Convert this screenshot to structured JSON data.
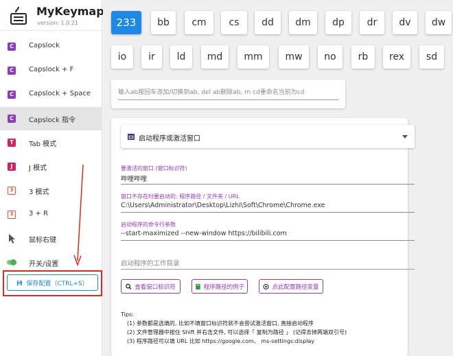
{
  "app": {
    "title": "MyKeymap",
    "version": "version: 1.0.21"
  },
  "sidebar": {
    "items": [
      {
        "badge": "C",
        "label": "Capslock"
      },
      {
        "badge": "C",
        "label": "Capslock + F"
      },
      {
        "badge": "C",
        "label": "Capslock + Space"
      },
      {
        "badge": "C",
        "label": "Capslock 指令"
      },
      {
        "badge": "T",
        "label": "Tab 模式"
      },
      {
        "badge": "J",
        "label": "J 模式"
      },
      {
        "badge": "3",
        "label": "3 模式"
      },
      {
        "badge": "3",
        "label": "3 + R"
      },
      {
        "badge": "",
        "label": "鼠标右键"
      },
      {
        "badge": "",
        "label": "开关/设置"
      }
    ],
    "save_label": "保存配置（CTRL+S）"
  },
  "keys": {
    "row1": [
      "233",
      "bb",
      "cm",
      "cs",
      "dd",
      "dm",
      "dp",
      "dr",
      "dv",
      "dw"
    ],
    "row2": [
      "io",
      "ir",
      "ld",
      "md",
      "mm",
      "mw",
      "no",
      "rb",
      "rex",
      "sd"
    ]
  },
  "command_input": {
    "placeholder": "输入ab按回车添加/切换到ab, del ab删除ab, rn cd重命名当前为cd"
  },
  "action": {
    "select_value": "启动程序或激活窗口",
    "fields": [
      {
        "label": "要激活的窗口 (窗口标识符)",
        "value": "哔哩哔哩"
      },
      {
        "label": "窗口不存在时要启动的: 程序路径 / 文件夹 / URL",
        "value": "C:\\Users\\Administrator\\Desktop\\Lizhi\\Soft\\Chrome\\Chrome.exe"
      },
      {
        "label": "启动程序的命令行参数",
        "value": "--start-maximized --new-window https://bilibili.com"
      }
    ],
    "workdir_placeholder": "启动程序的工作目录",
    "buttons": {
      "view_window_id": "查看窗口标识符",
      "path_examples": "程序路径的例子",
      "config_path_vars": "点此配置路径变量"
    },
    "tips": {
      "heading": "Tips:",
      "items": [
        "(1) 参数都是选填的, 比如不填窗口标识符就不会尝试激活窗口, 直接启动程序",
        "(2) 文件管理器中按住 Shift 并右击文件, 可以选择「 复制为路径 」 (记得去掉两端双引号)",
        "(3) 程序路径可以填 URL 比如 https://google.com、 ms-settings:display"
      ]
    }
  },
  "colors": {
    "accent": "#1e88e5",
    "purple": "#8e3bbd",
    "annotation_red": "#e3281e"
  }
}
